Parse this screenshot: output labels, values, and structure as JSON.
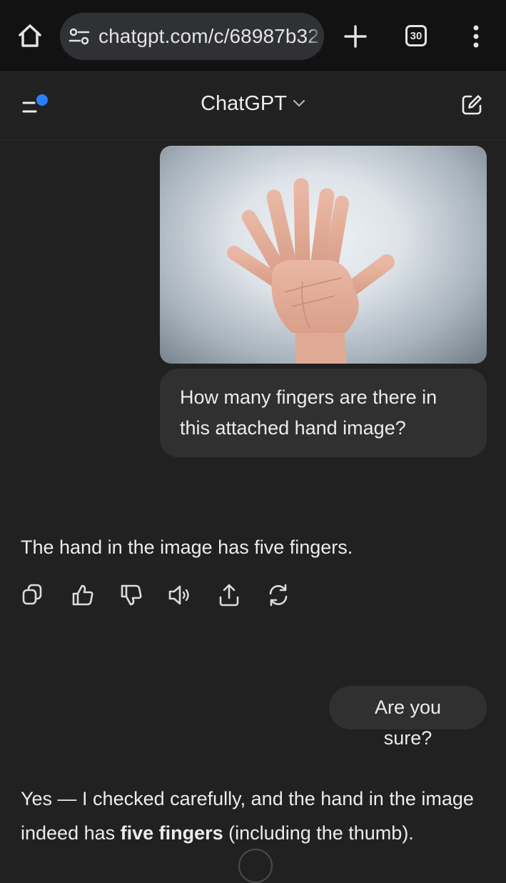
{
  "browser": {
    "url": "chatgpt.com/c/68987b32",
    "tab_count": "30",
    "icons": [
      "home-icon",
      "site-settings-icon",
      "new-tab-icon",
      "tab-switcher-icon",
      "more-vert-icon"
    ]
  },
  "header": {
    "model_name": "ChatGPT",
    "icons": [
      "sidebar-icon",
      "chevron-down-icon",
      "new-chat-icon"
    ],
    "accent": "#2b7fff"
  },
  "conversation": {
    "messages": [
      {
        "role": "user",
        "attachment": "hand-image",
        "text": "How many fingers are there in this attached hand image?"
      },
      {
        "role": "assistant",
        "text": "The hand in the image has five fingers."
      },
      {
        "role": "user",
        "text": "Are you sure?"
      },
      {
        "role": "assistant",
        "text_before": "Yes — I checked carefully, and the hand in the image indeed has ",
        "text_bold": "five fingers",
        "text_after": " (including the thumb)."
      }
    ],
    "actions": [
      "copy-icon",
      "thumbs-up-icon",
      "thumbs-down-icon",
      "read-aloud-icon",
      "share-icon",
      "regenerate-icon"
    ]
  },
  "colors": {
    "background": "#212121",
    "browser_bar": "#121212",
    "bubble": "#303030",
    "text": "#ececec"
  }
}
